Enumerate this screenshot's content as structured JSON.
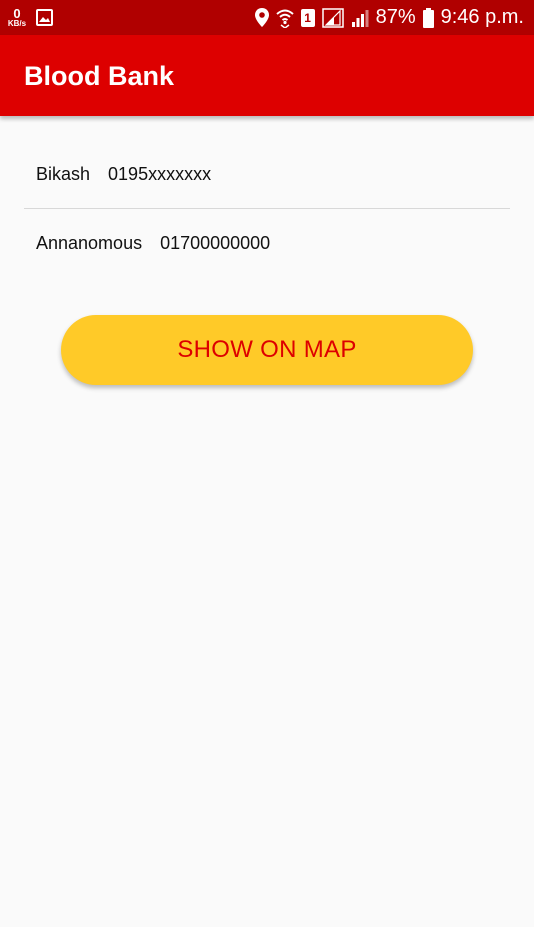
{
  "status_bar": {
    "data_speed_value": "0",
    "data_speed_unit": "KB/s",
    "sim_slot": "1",
    "battery": "87%",
    "time": "9:46 p.m."
  },
  "app_bar": {
    "title": "Blood Bank"
  },
  "donors": [
    {
      "name": "Bikash",
      "phone": "0195xxxxxxx"
    },
    {
      "name": "Annanomous",
      "phone": "01700000000"
    }
  ],
  "show_map_button": {
    "label": "SHOW ON MAP"
  },
  "colors": {
    "status_bar": "#b00000",
    "app_bar": "#dd0000",
    "button_bg": "#ffca28",
    "button_text": "#dd0000",
    "background": "#fafafa"
  },
  "icons": {
    "status_left": [
      "data-speed-icon",
      "gallery-icon"
    ],
    "status_right": [
      "location-icon",
      "wifi-icon",
      "sim-icon",
      "signal-icon",
      "signal-icon",
      "battery-icon"
    ]
  }
}
